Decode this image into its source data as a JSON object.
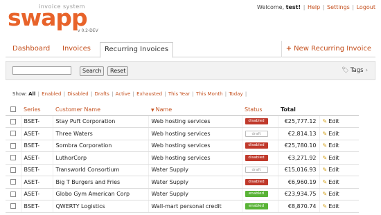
{
  "app": {
    "logo_text": "swapp",
    "tagline": "invoice system",
    "version": "v 0.2-DEV"
  },
  "topbar": {
    "welcome": "Welcome,",
    "username": "test!",
    "links": [
      "Help",
      "Settings",
      "Logout"
    ]
  },
  "tabs": [
    {
      "label": "Dashboard",
      "active": false
    },
    {
      "label": "Invoices",
      "active": false
    },
    {
      "label": "Recurring Invoices",
      "active": true
    }
  ],
  "new_button": {
    "icon": "plus-icon",
    "label": "New Recurring Invoice"
  },
  "search": {
    "value": "",
    "search_label": "Search",
    "reset_label": "Reset",
    "tags_label": "Tags"
  },
  "filters": {
    "show_label": "Show:",
    "items": [
      "All",
      "Enabled",
      "Disabled",
      "Drafts",
      "Active",
      "Exhausted",
      "This Year",
      "This Month",
      "Today"
    ]
  },
  "table": {
    "headers": [
      "Series",
      "Customer Name",
      "Name",
      "Status",
      "Total"
    ],
    "edit_label": "Edit",
    "rows": [
      {
        "series": "BSET-",
        "customer": "Stay Puft Corporation",
        "name": "Web hosting services",
        "status": "disabled",
        "total": "€25,777.12"
      },
      {
        "series": "ASET-",
        "customer": "Three Waters",
        "name": "Web hosting services",
        "status": "draft",
        "total": "€2,814.13"
      },
      {
        "series": "BSET-",
        "customer": "Sombra Corporation",
        "name": "Web hosting services",
        "status": "disabled",
        "total": "€25,780.10"
      },
      {
        "series": "ASET-",
        "customer": "LuthorCorp",
        "name": "Web hosting services",
        "status": "disabled",
        "total": "€3,271.92"
      },
      {
        "series": "BSET-",
        "customer": "Transworld Consortium",
        "name": "Water Supply",
        "status": "draft",
        "total": "€15,016.93"
      },
      {
        "series": "ASET-",
        "customer": "Big T Burgers and Fries",
        "name": "Water Supply",
        "status": "disabled",
        "total": "€6,960.19"
      },
      {
        "series": "ASET-",
        "customer": "Globo Gym American Corp",
        "name": "Water Supply",
        "status": "enabled",
        "total": "€23,934.75"
      },
      {
        "series": "BSET-",
        "customer": "QWERTY Logistics",
        "name": "Wall-mart personal credit",
        "status": "enabled",
        "total": "€8,870.74"
      }
    ]
  },
  "colors": {
    "accent": "#c4501e",
    "logo": "#e8632a",
    "disabled": "#c0392b",
    "enabled": "#59b336"
  }
}
